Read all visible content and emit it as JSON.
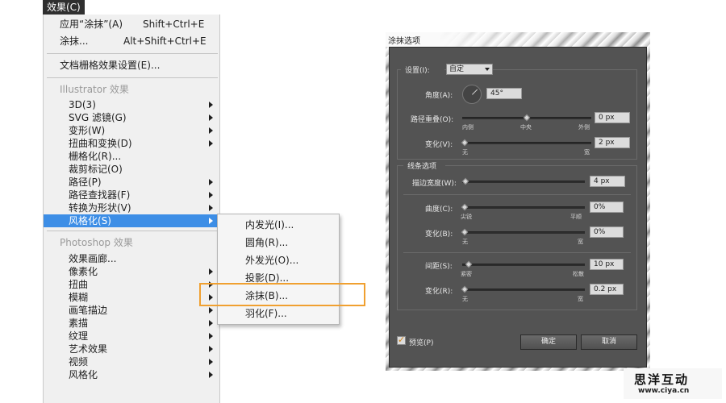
{
  "menu": {
    "title": "效果(C)",
    "top_items": [
      {
        "label": "应用“涂抹”(A)",
        "shortcut": "Shift+Ctrl+E"
      },
      {
        "label": "涂抹...",
        "shortcut": "Alt+Shift+Ctrl+E"
      },
      {
        "label": "文档栅格效果设置(E)..."
      }
    ],
    "illustrator_header": "Illustrator 效果",
    "illustrator_items": [
      {
        "label": "3D(3)",
        "has_submenu": true
      },
      {
        "label": "SVG 滤镜(G)",
        "has_submenu": true
      },
      {
        "label": "变形(W)",
        "has_submenu": true
      },
      {
        "label": "扭曲和变换(D)",
        "has_submenu": true
      },
      {
        "label": "栅格化(R)...",
        "has_submenu": false
      },
      {
        "label": "裁剪标记(O)",
        "has_submenu": false
      },
      {
        "label": "路径(P)",
        "has_submenu": true
      },
      {
        "label": "路径查找器(F)",
        "has_submenu": true
      },
      {
        "label": "转换为形状(V)",
        "has_submenu": true
      },
      {
        "label": "风格化(S)",
        "has_submenu": true,
        "highlighted": true
      }
    ],
    "photoshop_header": "Photoshop 效果",
    "photoshop_items": [
      {
        "label": "效果画廊...",
        "has_submenu": false
      },
      {
        "label": "像素化",
        "has_submenu": true
      },
      {
        "label": "扭曲",
        "has_submenu": true
      },
      {
        "label": "模糊",
        "has_submenu": true
      },
      {
        "label": "画笔描边",
        "has_submenu": true
      },
      {
        "label": "素描",
        "has_submenu": true
      },
      {
        "label": "纹理",
        "has_submenu": true
      },
      {
        "label": "艺术效果",
        "has_submenu": true
      },
      {
        "label": "视频",
        "has_submenu": true
      },
      {
        "label": "风格化",
        "has_submenu": true
      }
    ]
  },
  "submenu": {
    "items": [
      "内发光(I)...",
      "圆角(R)...",
      "外发光(O)...",
      "投影(D)...",
      "涂抹(B)...",
      "羽化(F)..."
    ],
    "highlight_color": "#f0a030"
  },
  "dialog": {
    "title": "涂抹选项",
    "settings_label": "设置(I):",
    "settings_value": "自定",
    "angle_label": "角度(A):",
    "angle_value": "45°",
    "path_overlap_label": "路径重叠(O):",
    "path_overlap_value": "0 px",
    "path_overlap_ticks": [
      "内侧",
      "中央",
      "外侧"
    ],
    "variation1_label": "变化(V):",
    "variation1_value": "2 px",
    "variation1_ticks": [
      "无",
      "宽"
    ],
    "line_options_label": "线条选项",
    "stroke_width_label": "描边宽度(W):",
    "stroke_width_value": "4 px",
    "curviness_label": "曲度(C):",
    "curviness_value": "0%",
    "curviness_ticks": [
      "尖锐",
      "平顺"
    ],
    "variation2_label": "变化(B):",
    "variation2_value": "0%",
    "variation2_ticks": [
      "无",
      "宽"
    ],
    "spacing_label": "间距(S):",
    "spacing_value": "10 px",
    "spacing_ticks": [
      "紧密",
      "松散"
    ],
    "variation3_label": "变化(R):",
    "variation3_value": "0.2 px",
    "variation3_ticks": [
      "无",
      "宽"
    ],
    "preview_label": "预览(P)",
    "preview_checked": true,
    "ok_label": "确定",
    "cancel_label": "取消",
    "bg_color": "#535353"
  },
  "watermark": {
    "chinese": "思洋互动",
    "url": "www.ciya.cn"
  }
}
